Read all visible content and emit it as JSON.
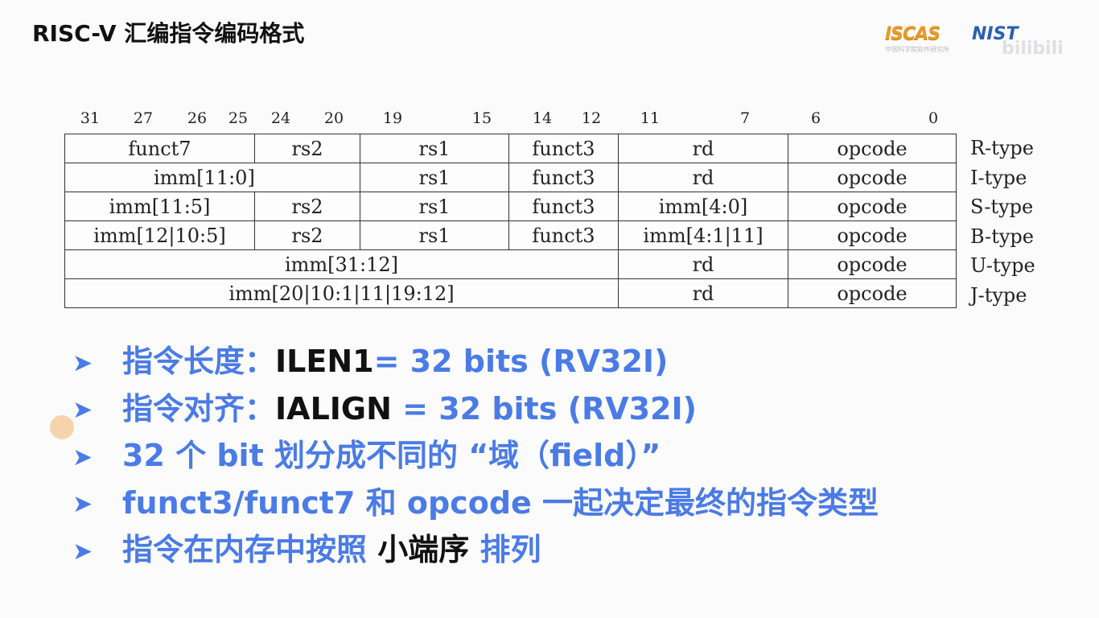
{
  "title": "RISC-V 汇编指令编码格式",
  "logos": {
    "iscas": "ISCAS",
    "nist": "NIST",
    "small": "中国科学院软件研究所",
    "watermark": "bilibili"
  },
  "bit_labels": [
    "31",
    "27",
    "26",
    "25",
    "24",
    "20",
    "19",
    "15",
    "14",
    "12",
    "11",
    "7",
    "6",
    "0"
  ],
  "formats": [
    {
      "type": "R-type",
      "fields": [
        "funct7",
        "rs2",
        "rs1",
        "funct3",
        "rd",
        "opcode"
      ]
    },
    {
      "type": "I-type",
      "fields": [
        "imm[11:0]",
        "rs1",
        "funct3",
        "rd",
        "opcode"
      ]
    },
    {
      "type": "S-type",
      "fields": [
        "imm[11:5]",
        "rs2",
        "rs1",
        "funct3",
        "imm[4:0]",
        "opcode"
      ]
    },
    {
      "type": "B-type",
      "fields": [
        "imm[12|10:5]",
        "rs2",
        "rs1",
        "funct3",
        "imm[4:1|11]",
        "opcode"
      ]
    },
    {
      "type": "U-type",
      "fields": [
        "imm[31:12]",
        "rd",
        "opcode"
      ]
    },
    {
      "type": "J-type",
      "fields": [
        "imm[20|10:1|11|19:12]",
        "rd",
        "opcode"
      ]
    }
  ],
  "bullets": [
    {
      "text": "指令长度：",
      "dark": "ILEN1",
      "rest": "= 32 bits (RV32I)"
    },
    {
      "text": "指令对齐：",
      "dark": "IALIGN",
      "rest": " = 32 bits (RV32I)"
    },
    {
      "text": "32 个 bit 划分成不同的 “域（field）”",
      "dark": "",
      "rest": ""
    },
    {
      "text": "funct3/funct7 和 opcode 一起决定最终的指令类型",
      "dark": "",
      "rest": ""
    },
    {
      "text": "指令在内存中按照 ",
      "dark": "小端序",
      "rest": " 排列"
    }
  ],
  "colors": {
    "accent": "#4a7be6",
    "text": "#111111"
  },
  "icons": {
    "bullet": "arrow-right-icon"
  }
}
